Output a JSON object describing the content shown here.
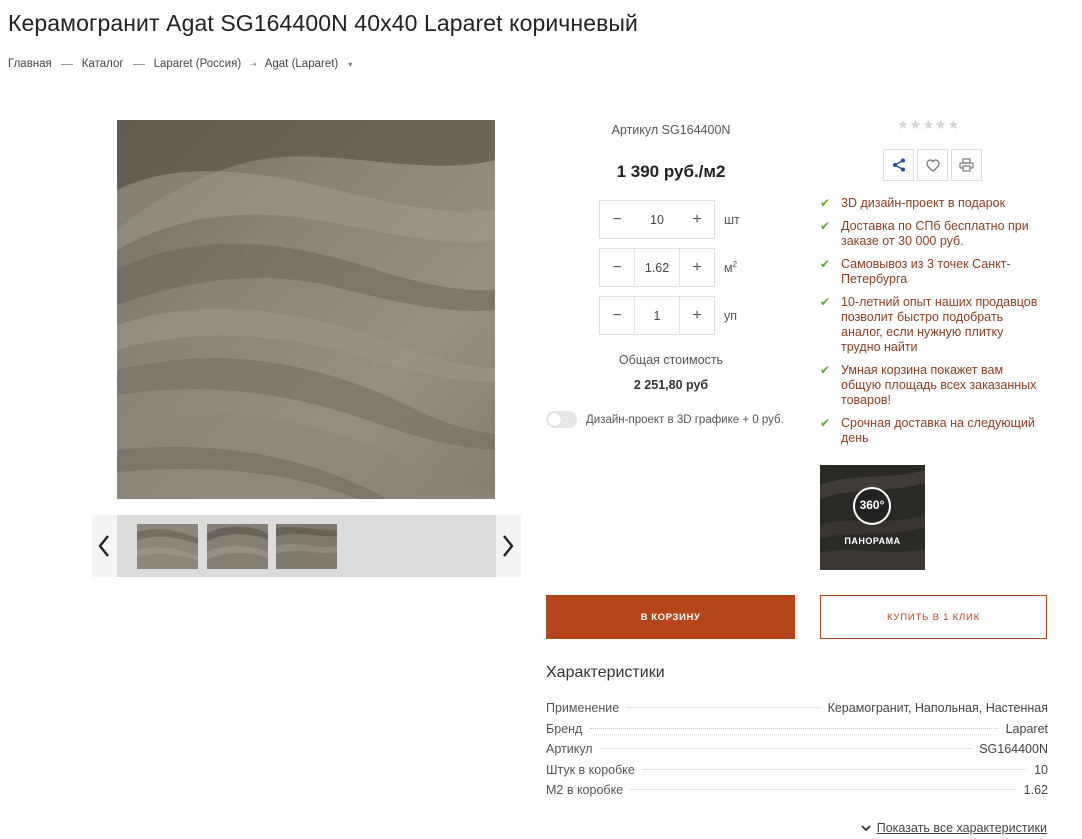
{
  "page": {
    "title": "Керамогранит Agat SG164400N 40x40 Laparet коричневый"
  },
  "breadcrumb": [
    {
      "label": "Главная"
    },
    {
      "label": "Каталог"
    },
    {
      "label": "Laparet (Россия)"
    },
    {
      "label": "Agat (Laparet)"
    }
  ],
  "gallery": {
    "thumbnail_count": 3,
    "prev_icon": "chevron-left-icon",
    "next_icon": "chevron-right-icon"
  },
  "product": {
    "sku_line": "Артикул SG164400N",
    "price": "1 390 руб./м2",
    "quantities": [
      {
        "value": "10",
        "unit": "шт",
        "sup": ""
      },
      {
        "value": "1.62",
        "unit": "м",
        "sup": "2"
      },
      {
        "value": "1",
        "unit": "уп",
        "sup": ""
      }
    ],
    "total_label": "Общая стоимость",
    "total_value": "2 251,80 руб",
    "design_toggle_label": "Дизайн-проект в 3D графике + 0 руб.",
    "design_toggle_on": false
  },
  "rating": {
    "value": 0,
    "max": 5
  },
  "actions": {
    "icons": [
      "share-icon",
      "heart-icon",
      "print-icon"
    ]
  },
  "benefits": [
    "3D дизайн-проект в подарок",
    "Доставка по СПб бесплатно при заказе от 30 000 руб.",
    "Самовывоз из 3 точек Санкт-Петербурга",
    "10-летний опыт наших продавцов позволит быстро подобрать аналог, если нужную плитку трудно найти",
    "Умная корзина покажет вам общую площадь всех заказанных товаров!",
    "Срочная доставка на следующий день"
  ],
  "panorama": {
    "badge": "360°",
    "label": "ПАНОРАМА"
  },
  "buttons": {
    "cart": "В КОРЗИНУ",
    "one_click": "КУПИТЬ В 1 КЛИК"
  },
  "specs": {
    "title": "Характеристики",
    "rows": [
      {
        "key": "Применение",
        "value": "Керамогранит, Напольная, Настенная"
      },
      {
        "key": "Бренд",
        "value": "Laparet"
      },
      {
        "key": "Артикул",
        "value": "SG164400N"
      },
      {
        "key": "Штук в коробке",
        "value": "10"
      },
      {
        "key": "М2 в коробке",
        "value": "1.62"
      }
    ],
    "show_all": "Показать все характеристики"
  },
  "colors": {
    "accent": "#b5451b",
    "benefit_text": "#8a3f1e",
    "check": "#66a52f",
    "stone_light": "#8e877d",
    "stone_dark": "#5d564d"
  }
}
